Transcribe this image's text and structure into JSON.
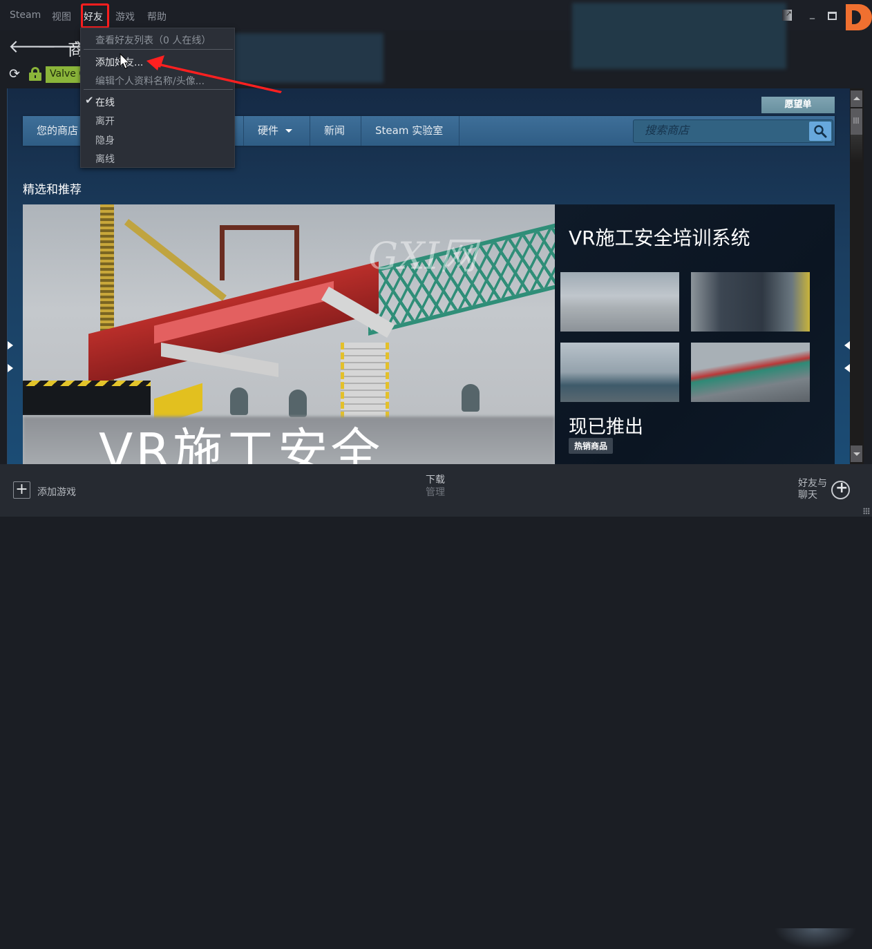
{
  "menubar": {
    "items": [
      "Steam",
      "视图",
      "好友",
      "游戏",
      "帮助"
    ],
    "active_index": 2
  },
  "window_controls": {
    "popout_icon": "popout-icon",
    "minimize_icon": "minimize-icon",
    "maximize_icon": "maximize-icon",
    "close_icon": "close-icon",
    "brand_badge": "D"
  },
  "nav": {
    "back_icon": "arrow-left-icon",
    "forward_icon": "arrow-right-icon",
    "page_title_fragment": "商",
    "reload_icon": "reload-icon",
    "lock_icon": "lock-icon",
    "certificate_label": "Valve C"
  },
  "friends_menu": {
    "items": [
      {
        "label": "查看好友列表（0 人在线）",
        "enabled": false
      },
      {
        "label": "添加好友...",
        "enabled": true
      },
      {
        "label": "编辑个人资料名称/头像...",
        "enabled": false
      }
    ],
    "status_items": [
      {
        "label": "在线",
        "checked": true
      },
      {
        "label": "离开",
        "checked": false
      },
      {
        "label": "隐身",
        "checked": false
      },
      {
        "label": "离线",
        "checked": false
      }
    ]
  },
  "store": {
    "wishlist_label": "愿望单",
    "nav_tabs": [
      {
        "label": "您的商店",
        "has_dropdown": false
      },
      {
        "label": "硬件",
        "has_dropdown": true
      },
      {
        "label": "新闻",
        "has_dropdown": false
      },
      {
        "label": "Steam 实验室",
        "has_dropdown": false
      }
    ],
    "search_placeholder": "搜索商店",
    "section_title": "精选和推荐",
    "featured": {
      "game_title": "VR施工安全培训系统",
      "hero_overlay_text": "VR施工安全",
      "watermark": "GXI网",
      "availability": "现已推出",
      "badge": "热销商品",
      "screenshot_count": 4
    }
  },
  "bottombar": {
    "add_game_label": "添加游戏",
    "downloads_line1": "下载",
    "downloads_line2": "管理",
    "friends_chat_label": "好友与\n聊天",
    "friends_chat_line1": "好友与",
    "friends_chat_line2": "聊天"
  },
  "colors": {
    "accent_green": "#8bb53a",
    "store_nav_blue": "#3e6f99",
    "highlight_red": "#ff1e1e",
    "brand_orange": "#f07030"
  }
}
